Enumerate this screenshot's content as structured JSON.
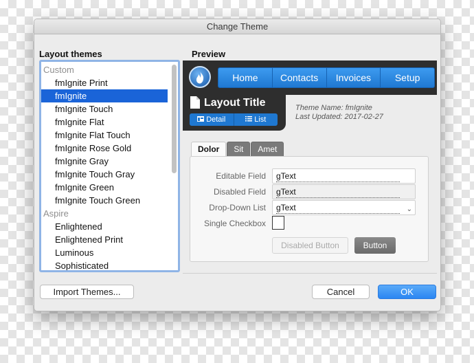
{
  "window": {
    "title": "Change Theme"
  },
  "themes": {
    "label": "Layout themes",
    "items": [
      {
        "label": "Custom",
        "group": true
      },
      {
        "label": "fmIgnite Print"
      },
      {
        "label": "fmIgnite",
        "selected": true
      },
      {
        "label": "fmIgnite Touch"
      },
      {
        "label": "fmIgnite Flat"
      },
      {
        "label": "fmIgnite Flat Touch"
      },
      {
        "label": "fmIgnite Rose Gold"
      },
      {
        "label": "fmIgnite Gray"
      },
      {
        "label": "fmIgnite Touch Gray"
      },
      {
        "label": "fmIgnite Green"
      },
      {
        "label": "fmIgnite Touch Green"
      },
      {
        "label": "Aspire",
        "group": true
      },
      {
        "label": "Enlightened"
      },
      {
        "label": "Enlightened Print"
      },
      {
        "label": "Luminous"
      },
      {
        "label": "Sophisticated"
      }
    ]
  },
  "preview": {
    "label": "Preview",
    "nav": [
      "Home",
      "Contacts",
      "Invoices",
      "Setup"
    ],
    "layout_title": "Layout Title",
    "seg_detail": "Detail",
    "seg_list": "List",
    "theme_name_line": "Theme Name:  fmIgnite",
    "last_updated_line": "Last Updated:  2017-02-27",
    "tabs": [
      "Dolor",
      "Sit",
      "Amet"
    ],
    "fields": {
      "editable_label": "Editable Field",
      "editable_value": "gText",
      "disabled_label": "Disabled Field",
      "disabled_value": "gText",
      "dropdown_label": "Drop-Down List",
      "dropdown_value": "gText",
      "checkbox_label": "Single Checkbox"
    },
    "disabled_button": "Disabled Button",
    "button": "Button"
  },
  "footer": {
    "import": "Import Themes...",
    "cancel": "Cancel",
    "ok": "OK"
  },
  "colors": {
    "selection": "#1a64d8",
    "nav_blue": "#2b89e6",
    "header_dark": "#2e2e2e",
    "ok_blue": "#2a86f2"
  }
}
